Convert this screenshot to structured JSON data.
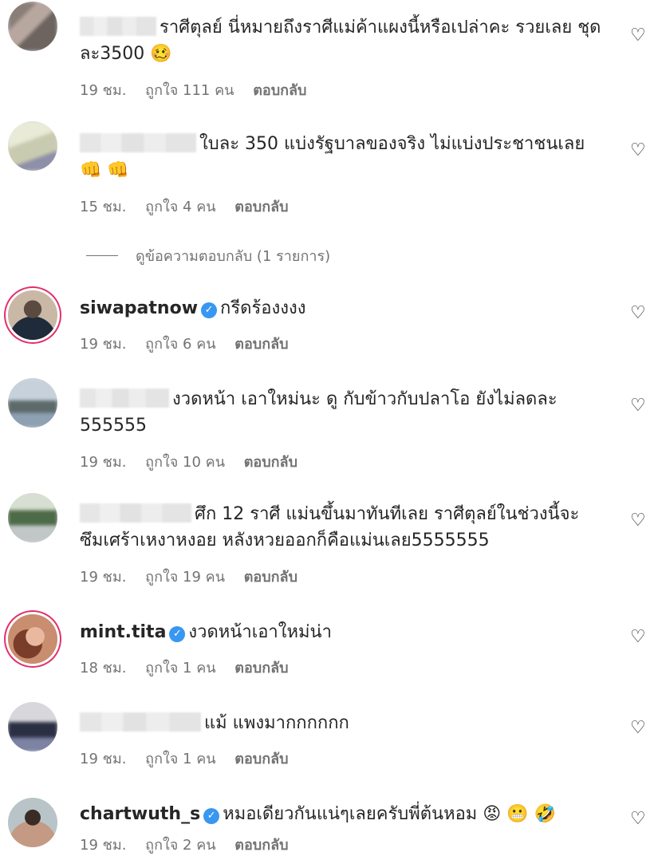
{
  "comments": [
    {
      "user": "",
      "line1": "ราศีตุลย์ นี่หมายถึงราศีแม่ค้าแผงนี้หรือเปล่าคะ รวยเลย ชุด",
      "line2": "ละ3500 🥴",
      "time": "19 ชม.",
      "likes": "ถูกใจ 111 คน",
      "reply": "ตอบกลับ"
    },
    {
      "user": "",
      "line1": "ใบละ 350 แบ่งรัฐบาลของจริง ไม่แบ่งประชาชนเลย",
      "line2": "👊 👊",
      "time": "15 ชม.",
      "likes": "ถูกใจ 4 คน",
      "reply": "ตอบกลับ"
    },
    {
      "user": "siwapatnow",
      "line1": "กรีดร้องงงง",
      "line2": "",
      "time": "19 ชม.",
      "likes": "ถูกใจ 6 คน",
      "reply": "ตอบกลับ"
    },
    {
      "user": "",
      "line1": "งวดหน้า เอาใหม่นะ ดู กับข้าวกับปลาโอ ยังไม่ลดละ",
      "line2": "555555",
      "time": "19 ชม.",
      "likes": "ถูกใจ 10 คน",
      "reply": "ตอบกลับ"
    },
    {
      "user": "",
      "line1": "ศึก 12 ราศี แม่นขึ้นมาทันทีเลย ราศีตุลย์ในช่วงนี้จะ",
      "line2": "ซึมเศร้าเหงาหงอย หลังหวยออกก็คือแม่นเลย5555555",
      "time": "19 ชม.",
      "likes": "ถูกใจ 19 คน",
      "reply": "ตอบกลับ"
    },
    {
      "user": "mint.tita",
      "line1": "งวดหน้าเอาใหม่น่า",
      "line2": "",
      "time": "18 ชม.",
      "likes": "ถูกใจ 1 คน",
      "reply": "ตอบกลับ"
    },
    {
      "user": "",
      "line1": "แม้ แพงมากกกกกก",
      "line2": "",
      "time": "19 ชม.",
      "likes": "ถูกใจ 1 คน",
      "reply": "ตอบกลับ"
    },
    {
      "user": "chartwuth_s",
      "line1": "หมอเดียวกันแน่ๆเลยครับพี่ต้นหอม 😡 😬 🤣",
      "line2": "",
      "time": "19 ชม.",
      "likes": "ถูกใจ 2 คน",
      "reply": "ตอบกลับ"
    }
  ],
  "view_replies": "ดูข้อความตอบกลับ (1 รายการ)",
  "icons": {
    "like": "heart-outline-icon",
    "verified": "verified-badge-icon"
  },
  "colors": {
    "verified": "#3897f0",
    "meta": "#737373",
    "text": "#262626"
  }
}
